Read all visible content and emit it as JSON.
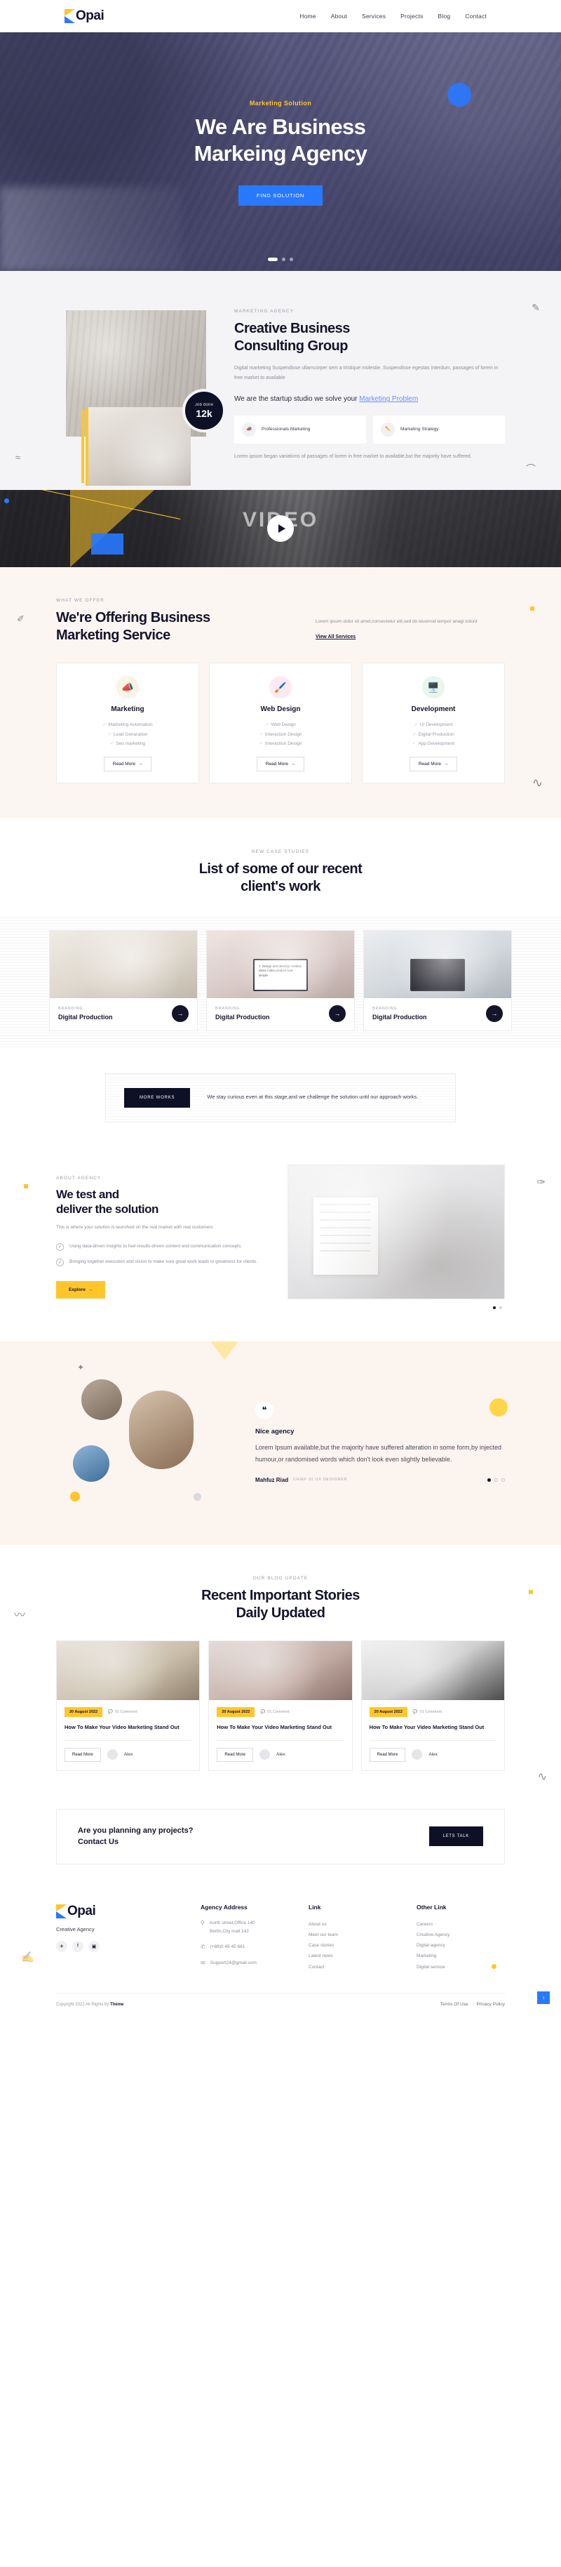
{
  "brand": {
    "name": "Opai",
    "tagline": "Creative Agency"
  },
  "nav": {
    "items": [
      "Home",
      "About",
      "Services",
      "Projects",
      "Blog",
      "Contact"
    ]
  },
  "hero": {
    "eyebrow": "Marketing Solution",
    "title_line1": "We Are Business",
    "title_line2": "Markeing Agency",
    "button": "FIND SOLUTION"
  },
  "about": {
    "eyebrow": "MARKETING AGENCY",
    "title_line1": "Creative Business",
    "title_line2": "Consulting Group",
    "paragraph": "Digital marketing Suspendisse ullamcorper sem a tristique molestie. Suspendisse egestas interdum, passages of lorem in free market to available",
    "lead_prefix": "We are the startup studio we solve your ",
    "lead_link": "Marketing Problem",
    "badge_label": "Job done",
    "badge_value": "12k",
    "cards": [
      {
        "icon": "megaphone-icon",
        "glyph": "📣",
        "label": "Professionals Marketing"
      },
      {
        "icon": "pencil-icon",
        "glyph": "✏️",
        "label": "Marketing Strategy"
      }
    ],
    "footnote": "Lorem ipsum began variations of passages of lorem in free market to available,but the majority have suffered."
  },
  "video": {
    "word": "VIDEO",
    "play_label": "play-button"
  },
  "services": {
    "eyebrow": "WHAT WE OFFER",
    "title_line1": "We're Offering Business",
    "title_line2": "Marketing Service",
    "side_text": "Lorem ipsum dolor sit amet,consectetur elit,sed do eiusmod tempor anagi icdunt",
    "view_all": "View All Services",
    "read_more": "Read More",
    "cards": [
      {
        "icon": "megaphone-icon",
        "glyph": "📣",
        "bg": "#FBF3E3",
        "title": "Marketing",
        "items": [
          "Marketing Automation",
          "Lead Genaration",
          "Seo marketing"
        ]
      },
      {
        "icon": "design-tool-icon",
        "glyph": "🖌️",
        "bg": "#FBEAF4",
        "title": "Web Design",
        "items": [
          "Web Design",
          "Interaction Design",
          "Interaction Design"
        ]
      },
      {
        "icon": "code-window-icon",
        "glyph": "🖥️",
        "bg": "#E8F6EC",
        "title": "Development",
        "items": [
          "UI Development",
          "Digital Production",
          "App Development"
        ]
      }
    ]
  },
  "cases": {
    "eyebrow": "NEW CASE STUDIES",
    "title_line1": "List of some of our recent",
    "title_line2": "client's work",
    "items": [
      {
        "tag": "BRANDING",
        "title": "Digital Production",
        "laptop_text": ""
      },
      {
        "tag": "BRANDING",
        "title": "Digital Production",
        "laptop_text": "1. design and develop creative ideas make product look simple"
      },
      {
        "tag": "BRANDING",
        "title": "Digital Production",
        "laptop_text": ""
      }
    ]
  },
  "more_works": {
    "button": "MORE WORKS",
    "text": "We stay curious even at this stage,and we challenge the solution until our approach works."
  },
  "solution": {
    "eyebrow": "ABOUT AGENCY",
    "title_line1": "We test and",
    "title_line2": "deliver the solution",
    "paragraph": "This is where your solution is launched on the real market with real customers",
    "points": [
      "Using data-driven insights to fuel results-driven content and communication concepts.",
      "Bringing together execution and vision to make sure great work leads to greatness for clients."
    ],
    "button": "Explore"
  },
  "testimonial": {
    "title": "Nice agency",
    "text": "Lorem Ipsum available,but the majority have suffered alteration in some form,by injected humour,or randomised words which don't look even slightly believable.",
    "name": "Mahfuz Riad",
    "role": "CHIEF UI UX DESIGNER"
  },
  "blog": {
    "eyebrow": "OUR BLOG UPDATE",
    "title_line1": "Recent Important Stories",
    "title_line2": "Daily Updated",
    "read_more": "Read More",
    "posts": [
      {
        "date": "20 August 2022",
        "comments": "01 Comment",
        "title": "How To Make Your Video Marketing Stand Out",
        "author": "Alex"
      },
      {
        "date": "20 August 2022",
        "comments": "01 Comment",
        "title": "How To Make Your Video Marketing Stand Out",
        "author": "Alex"
      },
      {
        "date": "20 August 2022",
        "comments": "01 Comment",
        "title": "How To Make Your Video Marketing Stand Out",
        "author": "Alex"
      }
    ]
  },
  "cta": {
    "line1": "Are you planning any projects?",
    "line2": "Contact Us",
    "button": "LETS TALK"
  },
  "footer": {
    "address_heading": "Agency Address",
    "address_line1": "Aorth street,Office 140",
    "address_line2": "Berlin,City mall 142",
    "phone": "(+88)0 45 45 661",
    "email": "Support24@gmail.com",
    "link_heading": "Link",
    "links": [
      "About us",
      "Meet our team",
      "Case stories",
      "Latest news",
      "Contact"
    ],
    "other_heading": "Other Link",
    "other_links": [
      "Careers",
      "Creative Agency",
      "Digital agency",
      "Marketing",
      "Digital service"
    ],
    "copyright_prefix": "Copyright 2022 All Rights by ",
    "copyright_brand": "Theme",
    "terms": "Terms Of Use",
    "privacy": "Privacy Policy"
  },
  "colors": {
    "accent_blue": "#2979FF",
    "accent_yellow": "#FFC62B",
    "dark": "#14142b"
  }
}
